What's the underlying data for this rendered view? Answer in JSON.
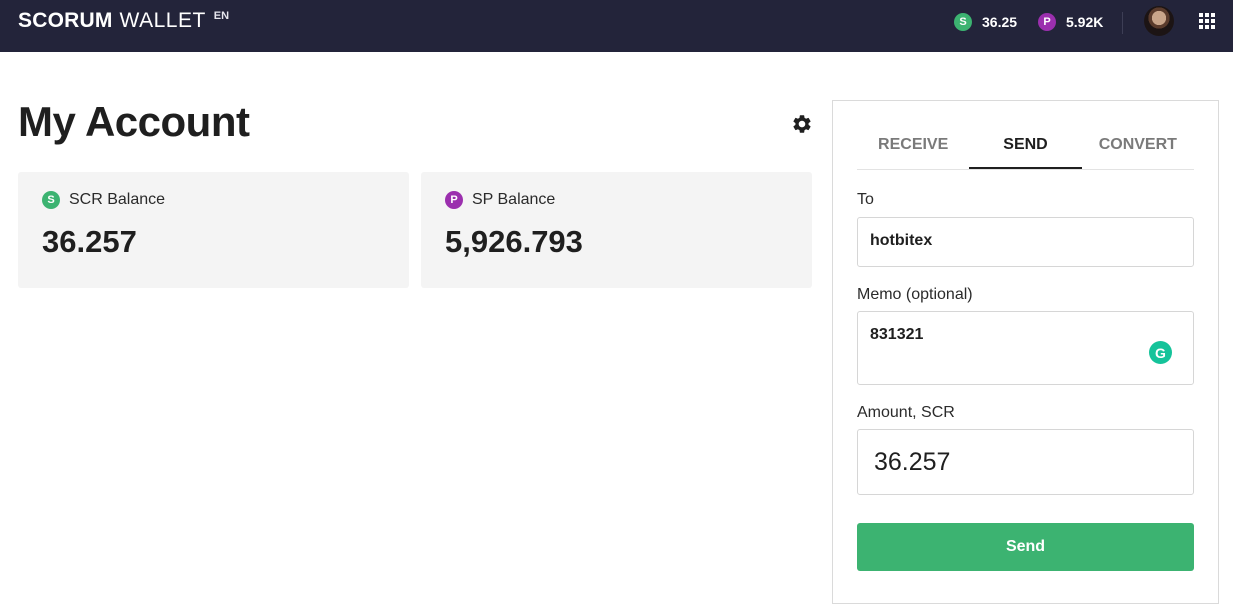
{
  "header": {
    "logo_brand": "SCORUM",
    "logo_wallet": "WALLET",
    "language": "EN",
    "scr_icon": "S",
    "scr_value": "36.25",
    "sp_icon": "P",
    "sp_value": "5.92K"
  },
  "main": {
    "title": "My Account",
    "cards": [
      {
        "icon": "S",
        "label": "SCR Balance",
        "value": "36.257"
      },
      {
        "icon": "P",
        "label": "SP Balance",
        "value": "5,926.793"
      }
    ]
  },
  "panel": {
    "tabs": [
      {
        "label": "RECEIVE",
        "active": false
      },
      {
        "label": "SEND",
        "active": true
      },
      {
        "label": "CONVERT",
        "active": false
      }
    ],
    "to_label": "To",
    "to_value": "hotbitex",
    "memo_label": "Memo (optional)",
    "memo_value": "831321",
    "grammarly_icon": "G",
    "amount_label": "Amount, SCR",
    "amount_value": "36.257",
    "send_label": "Send"
  },
  "colors": {
    "header_bg": "#23243a",
    "scr_green": "#3cb371",
    "sp_purple": "#9b2fae",
    "card_bg": "#f4f4f4",
    "grammarly": "#15c39a"
  }
}
